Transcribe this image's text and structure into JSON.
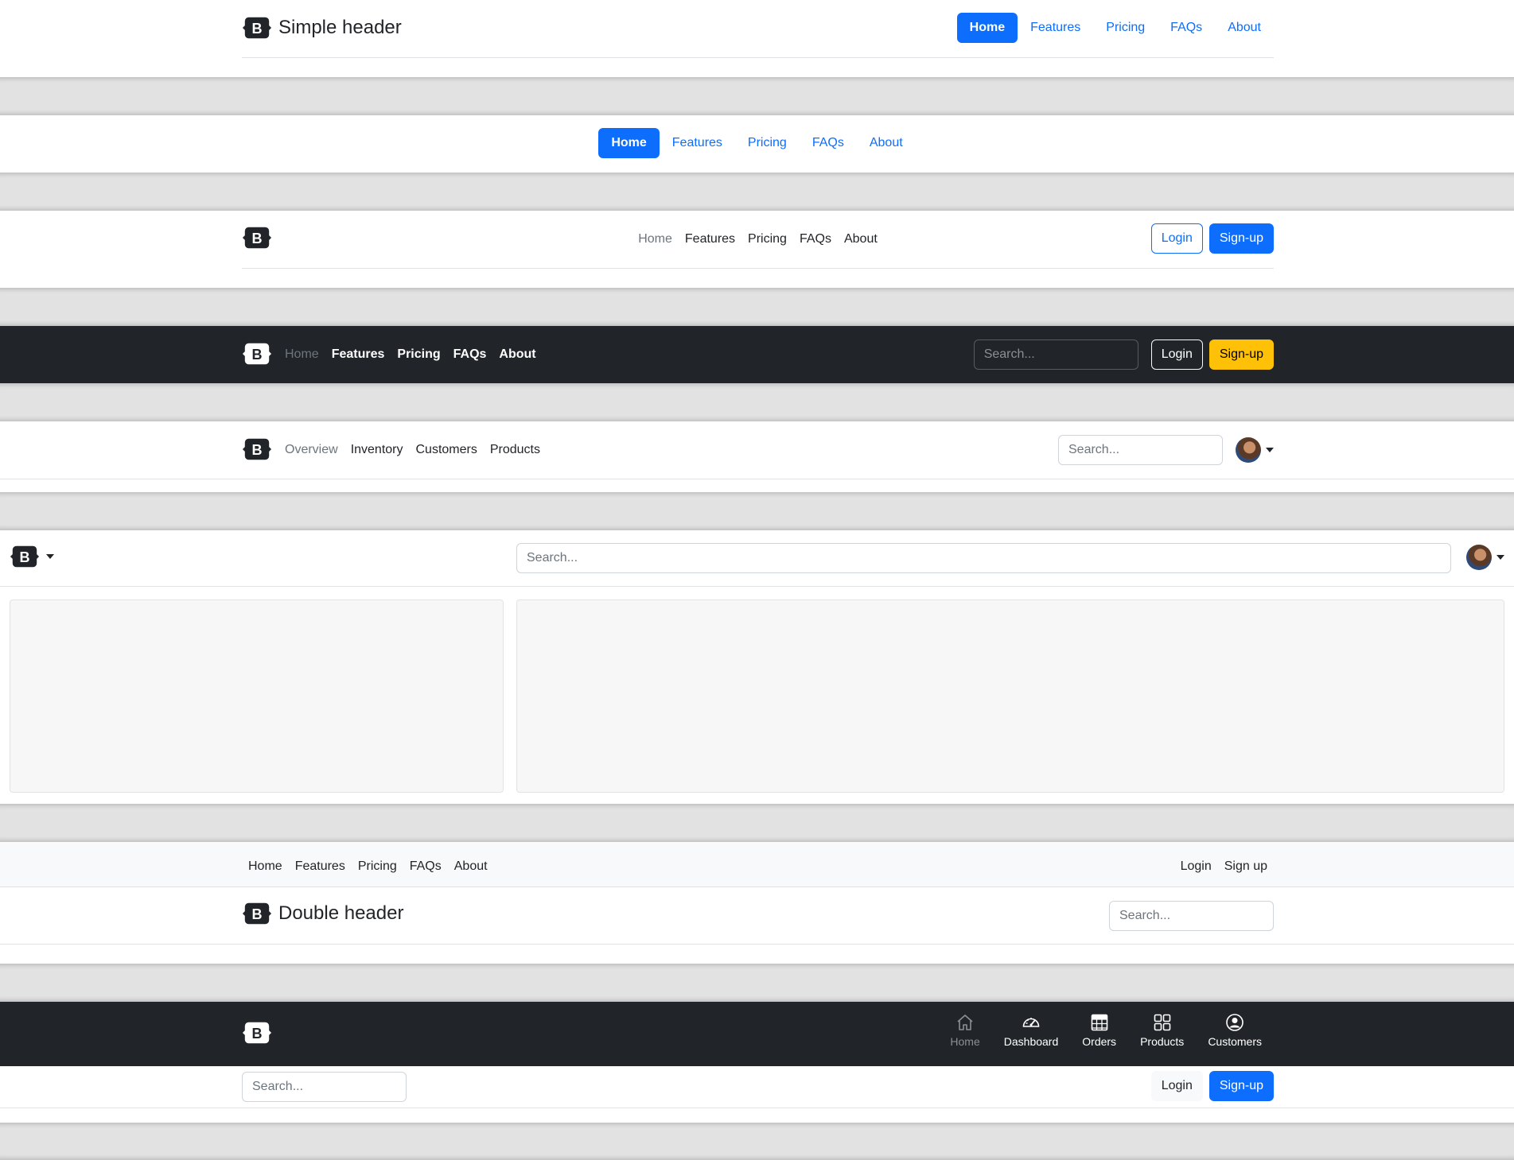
{
  "header1": {
    "title": "Simple header",
    "nav": [
      "Home",
      "Features",
      "Pricing",
      "FAQs",
      "About"
    ],
    "active": "Home"
  },
  "header2": {
    "nav": [
      "Home",
      "Features",
      "Pricing",
      "FAQs",
      "About"
    ],
    "active": "Home"
  },
  "header3": {
    "nav": [
      "Home",
      "Features",
      "Pricing",
      "FAQs",
      "About"
    ],
    "login_label": "Login",
    "signup_label": "Sign-up"
  },
  "header4": {
    "nav": [
      "Home",
      "Features",
      "Pricing",
      "FAQs",
      "About"
    ],
    "search_placeholder": "Search...",
    "login_label": "Login",
    "signup_label": "Sign-up"
  },
  "header5": {
    "nav": [
      "Overview",
      "Inventory",
      "Customers",
      "Products"
    ],
    "search_placeholder": "Search..."
  },
  "header6": {
    "search_placeholder": "Search..."
  },
  "header7": {
    "top_nav": [
      "Home",
      "Features",
      "Pricing",
      "FAQs",
      "About"
    ],
    "login_label": "Login",
    "signup_label": "Sign up",
    "title": "Double header",
    "search_placeholder": "Search..."
  },
  "header8": {
    "icons": [
      {
        "label": "Home",
        "icon": "home-icon"
      },
      {
        "label": "Dashboard",
        "icon": "speedometer-icon"
      },
      {
        "label": "Orders",
        "icon": "table-icon"
      },
      {
        "label": "Products",
        "icon": "grid-icon"
      },
      {
        "label": "Customers",
        "icon": "person-circle-icon"
      }
    ],
    "search_placeholder": "Search...",
    "login_label": "Login",
    "signup_label": "Sign-up"
  },
  "colors": {
    "primary": "#0d6efd",
    "dark": "#212529",
    "warning": "#ffc107",
    "divider": "#e2e2e2"
  }
}
